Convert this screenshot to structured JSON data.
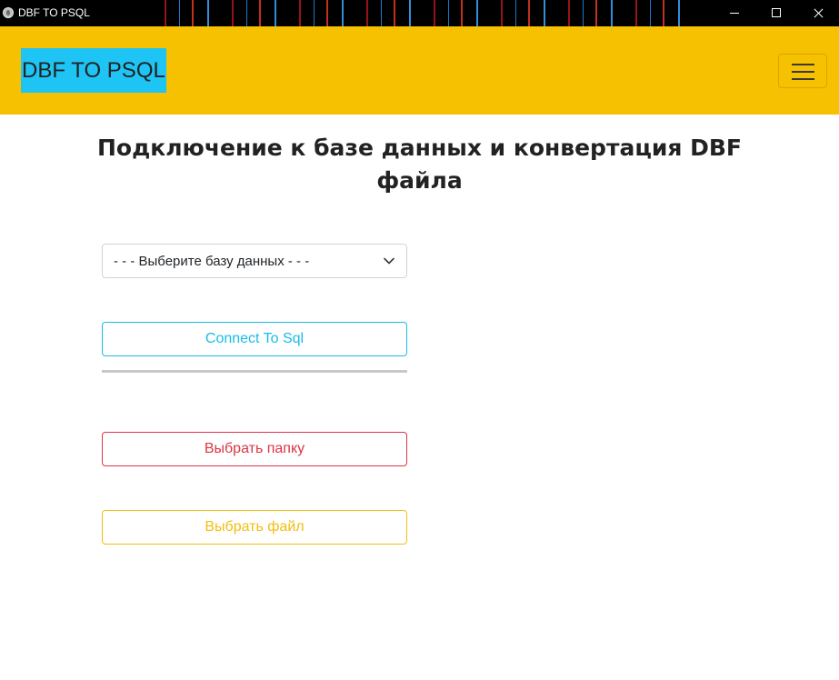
{
  "window": {
    "title": "DBF TO PSQL",
    "controls": [
      "minimize-icon",
      "maximize-icon",
      "close-icon"
    ]
  },
  "navbar": {
    "brand": "DBF TO PSQL",
    "brand_background": "#1ec4f4",
    "background": "#f5c100",
    "toggler_icon": "hamburger-icon"
  },
  "main": {
    "heading_line1": "Подключение к базе данных и конвертация DBF",
    "heading_line2": "файла",
    "database_select": {
      "selected": "- - - Выберите базу данных - - -",
      "icon": "chevron-down-icon"
    },
    "connect_button": {
      "label": "Connect To Sql",
      "color": "#17bde6"
    },
    "choose_folder_button": {
      "label": "Выбрать папку",
      "color": "#dc3545"
    },
    "choose_file_button": {
      "label": "Выбрать файл",
      "color": "#f3bd10"
    }
  }
}
